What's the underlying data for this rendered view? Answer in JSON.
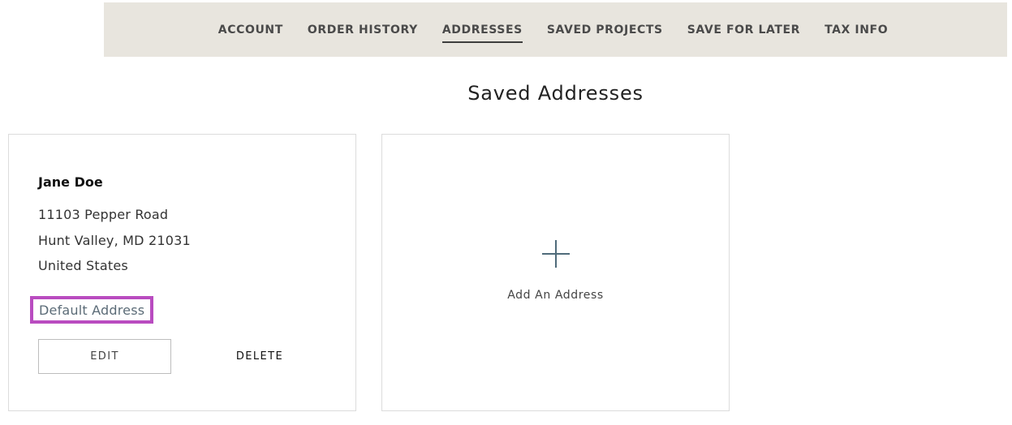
{
  "nav": {
    "items": [
      {
        "label": "ACCOUNT"
      },
      {
        "label": "ORDER HISTORY"
      },
      {
        "label": "ADDRESSES"
      },
      {
        "label": "SAVED PROJECTS"
      },
      {
        "label": "SAVE FOR LATER"
      },
      {
        "label": "TAX INFO"
      }
    ],
    "active": "ADDRESSES"
  },
  "page": {
    "title": "Saved Addresses"
  },
  "address_card": {
    "name": "Jane Doe",
    "line1": "11103 Pepper Road",
    "line2": "Hunt Valley, MD 21031",
    "line3": "United States",
    "default_label": "Default Address",
    "edit_label": "EDIT",
    "delete_label": "DELETE"
  },
  "add_card": {
    "icon": "plus-icon",
    "label": "Add An Address"
  },
  "colors": {
    "nav_background": "#e8e5de",
    "highlight_border": "#b94cc0",
    "accent_icon": "#4f6b7a"
  }
}
